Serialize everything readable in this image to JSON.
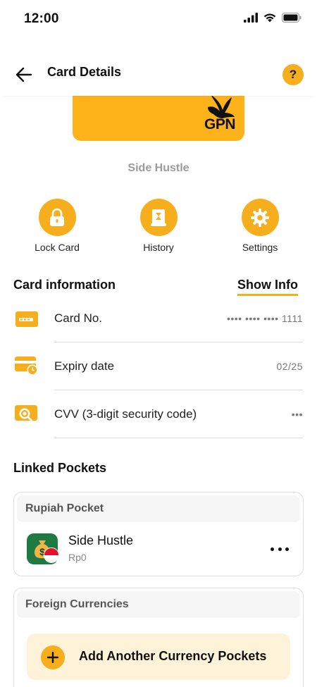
{
  "status_bar": {
    "time": "12:00",
    "icons": [
      "signal-icon",
      "wifi-icon",
      "battery-icon"
    ]
  },
  "header": {
    "title": "Card Details",
    "back_icon": "arrow-left-icon",
    "help_label": "?"
  },
  "card": {
    "network_logo_text": "GPN",
    "card_color": "#ffb31a"
  },
  "pocket_name": "Side Hustle",
  "quick_actions": [
    {
      "label": "Lock Card",
      "icon": "lock-icon"
    },
    {
      "label": "History",
      "icon": "receipt-icon"
    },
    {
      "label": "Settings",
      "icon": "gear-icon"
    }
  ],
  "card_information": {
    "title": "Card information",
    "show_info_label": "Show Info",
    "rows": [
      {
        "label": "Card No.",
        "value": "•••• •••• •••• 1111",
        "icon": "card-icon"
      },
      {
        "label": "Expiry date",
        "value": "02/25",
        "icon": "card-clock-icon"
      },
      {
        "label": "CVV (3-digit security code)",
        "value": "•••",
        "icon": "card-search-icon"
      }
    ]
  },
  "linked_pockets": {
    "title": "Linked Pockets",
    "rupiah": {
      "header": "Rupiah Pocket",
      "item_name": "Side Hustle",
      "item_balance": "Rp0"
    },
    "foreign": {
      "header": "Foreign Currencies",
      "add_label": "Add Another Currency Pockets"
    }
  },
  "colors": {
    "accent": "#f6ae1d",
    "accent_light": "#fef3d9",
    "pocket_avatar": "#1e7a42"
  }
}
